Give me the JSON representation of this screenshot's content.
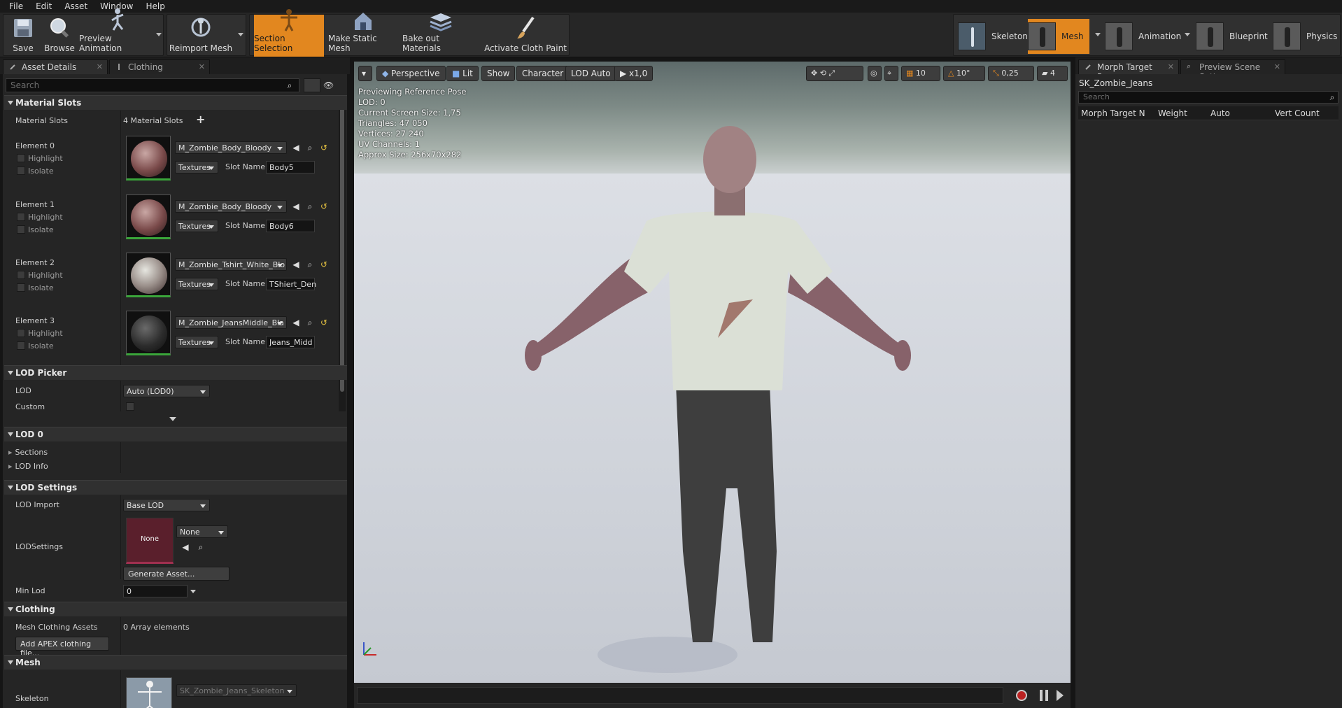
{
  "menu": [
    "File",
    "Edit",
    "Asset",
    "Window",
    "Help"
  ],
  "toolbar": {
    "save": "Save",
    "browse": "Browse",
    "preview_animation": "Preview Animation",
    "reimport_mesh": "Reimport Mesh",
    "section_selection": "Section Selection",
    "make_static_mesh": "Make Static Mesh",
    "bake_out_materials": "Bake out Materials",
    "activate_cloth_paint": "Activate Cloth Paint"
  },
  "modes": [
    "Skeleton",
    "Mesh",
    "Animation",
    "Blueprint",
    "Physics"
  ],
  "left_tabs": [
    "Asset Details",
    "Clothing"
  ],
  "search_placeholder": "Search",
  "material_slots": {
    "header": "Material Slots",
    "label": "Material Slots",
    "count_text": "4 Material Slots",
    "elements": [
      {
        "name": "Element 0",
        "material": "M_Zombie_Body_Bloody",
        "slot_name": "Body5"
      },
      {
        "name": "Element 1",
        "material": "M_Zombie_Body_Bloody",
        "slot_name": "Body6"
      },
      {
        "name": "Element 2",
        "material": "M_Zombie_Tshirt_White_Blo",
        "slot_name": "TShiert_Den"
      },
      {
        "name": "Element 3",
        "material": "M_Zombie_JeansMiddle_Bla",
        "slot_name": "Jeans_Midd"
      }
    ],
    "highlight": "Highlight",
    "isolate": "Isolate",
    "textures": "Textures",
    "slot_name_label": "Slot Name"
  },
  "lod_picker": {
    "header": "LOD Picker",
    "lod_label": "LOD",
    "lod_value": "Auto (LOD0)",
    "custom_label": "Custom"
  },
  "lod0": {
    "header": "LOD 0",
    "sections": "Sections",
    "lod_info": "LOD Info"
  },
  "lod_settings": {
    "header": "LOD Settings",
    "lod_import_label": "LOD Import",
    "lod_import_value": "Base LOD",
    "lodsettings_label": "LODSettings",
    "none_thumb": "None",
    "none_combo": "None",
    "generate": "Generate Asset...",
    "min_lod_label": "Min Lod",
    "min_lod_value": "0"
  },
  "clothing": {
    "header": "Clothing",
    "assets_label": "Mesh Clothing Assets",
    "assets_value": "0 Array elements",
    "add_button": "Add APEX clothing file..."
  },
  "mesh": {
    "header": "Mesh",
    "skeleton_label": "Skeleton",
    "skeleton_value": "SK_Zombie_Jeans_Skeleton"
  },
  "viewport": {
    "perspective": "Perspective",
    "lit": "Lit",
    "show": "Show",
    "character": "Character",
    "lod_auto": "LOD Auto",
    "speed": "x1,0",
    "grid": "10",
    "angle": "10°",
    "scale": "0,25",
    "cam_speed": "4",
    "info": [
      "Previewing Reference Pose",
      "LOD: 0",
      "Current Screen Size: 1,75",
      "Triangles: 47 050",
      "Vertices: 27 240",
      "UV Channels: 1",
      "Approx Size: 256x70x282"
    ]
  },
  "right": {
    "tabs": [
      "Morph Target Prev",
      "Preview Scene Sett"
    ],
    "asset": "SK_Zombie_Jeans",
    "columns": [
      "Morph Target N",
      "Weight",
      "Auto",
      "Vert Count"
    ]
  },
  "colors": {
    "accent": "#e2871f",
    "panel": "#252525",
    "viewport_floor": "#d6d8dc"
  }
}
